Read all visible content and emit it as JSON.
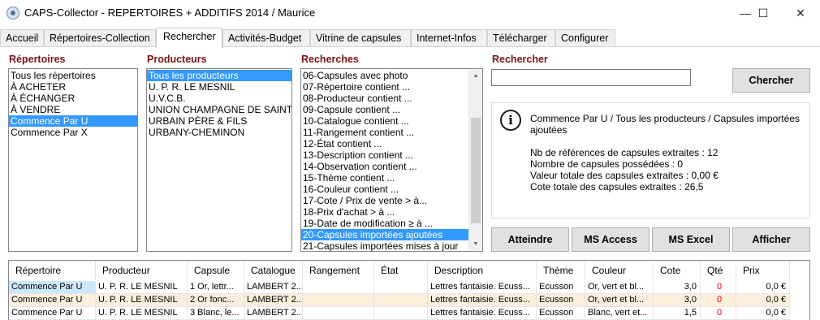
{
  "window": {
    "title": "CAPS-Collector - REPERTOIRES + ADDITIFS 2014 / Maurice",
    "minimize_icon": "minimize-icon",
    "maximize_icon": "maximize-icon",
    "close_icon": "close-icon",
    "min_glyph": "—",
    "max_glyph": "☐",
    "close_glyph": "✕"
  },
  "tabs": [
    {
      "label": "Accueil"
    },
    {
      "label": "Répertoires-Collection"
    },
    {
      "label": "Rechercher"
    },
    {
      "label": "Activités-Budget"
    },
    {
      "label": "Vitrine de capsules"
    },
    {
      "label": "Internet-Infos"
    },
    {
      "label": "Télécharger"
    },
    {
      "label": "Configurer"
    }
  ],
  "repertoires": {
    "label": "Répertoires",
    "items": [
      "Tous les répertoires",
      "À ACHETER",
      "À ÉCHANGER",
      "À VENDRE",
      "Commence Par U",
      "Commence Par X"
    ],
    "selected": "Commence Par U"
  },
  "producteurs": {
    "label": "Producteurs",
    "items": [
      "Tous les producteurs",
      "U. P. R. LE MESNIL",
      "U.V.C.B.",
      "UNION CHAMPAGNE DE SAINT-GANDEBERT",
      "URBAIN PÈRE & FILS",
      "URBANY-CHEMINON"
    ],
    "selected": "Tous les producteurs"
  },
  "recherches": {
    "label": "Recherches",
    "items": [
      "06-Capsules avec photo",
      "07-Répertoire contient ...",
      "08-Producteur contient ...",
      "09-Capsule contient ...",
      "10-Catalogue contient ...",
      "11-Rangement contient ...",
      "12-État contient ...",
      "13-Description contient ...",
      "14-Observation contient ...",
      "15-Thème contient ...",
      "16-Couleur contient ...",
      "17-Cote / Prix de vente > à...",
      "18-Prix d'achat > à ...",
      "19-Date de modification ≥ à ...",
      "20-Capsules importées ajoutées",
      "21-Capsules importées mises à jour"
    ],
    "selected": "20-Capsules importées ajoutées",
    "scroll_up": "▲",
    "scroll_down": "▼"
  },
  "rechercher": {
    "label": "Rechercher",
    "input_value": "",
    "button": "Chercher"
  },
  "info": {
    "icon": "info-icon",
    "icon_glyph": "i",
    "line1": "Commence Par U / Tous les producteurs / Capsules importées",
    "line2": "ajoutées",
    "stats": [
      "Nb de références de capsules extraites : 12",
      "Nombre de capsules possédées : 0",
      "Valeur totale des capsules extraites : 0,00 €",
      "Cote totale des capsules extraites : 26,5"
    ]
  },
  "actions": {
    "atteindre": "Atteindre",
    "ms_access": "MS Access",
    "ms_excel": "MS Excel",
    "afficher": "Afficher"
  },
  "grid": {
    "columns": [
      "Répertoire",
      "Producteur",
      "Capsule",
      "Catalogue",
      "Rangement",
      "État",
      "Description",
      "Thème",
      "Couleur",
      "Cote",
      "Qté",
      "Prix"
    ],
    "rows": [
      [
        "Commence Par U",
        "U. P. R. LE MESNIL",
        "1 Or, lettr...",
        "LAMBERT 2...",
        "",
        "",
        "Lettres fantaisie. Ecuss...",
        "Ecusson",
        "Or, vert et bl...",
        "3,0",
        "0",
        "0,0 €"
      ],
      [
        "Commence Par U",
        "U. P. R. LE MESNIL",
        "2 Or fonc...",
        "LAMBERT 2...",
        "",
        "",
        "Lettres fantaisie. Ecuss...",
        "Ecusson",
        "Or, vert et bl...",
        "3,0",
        "0",
        "0,0 €"
      ],
      [
        "Commence Par U",
        "U. P. R. LE MESNIL",
        "3 Blanc, le...",
        "LAMBERT 2...",
        "",
        "",
        "Lettres fantaisie. Ecuss...",
        "Ecusson",
        "Blanc, vert et...",
        "1,5",
        "0",
        "0,0 €"
      ]
    ]
  }
}
